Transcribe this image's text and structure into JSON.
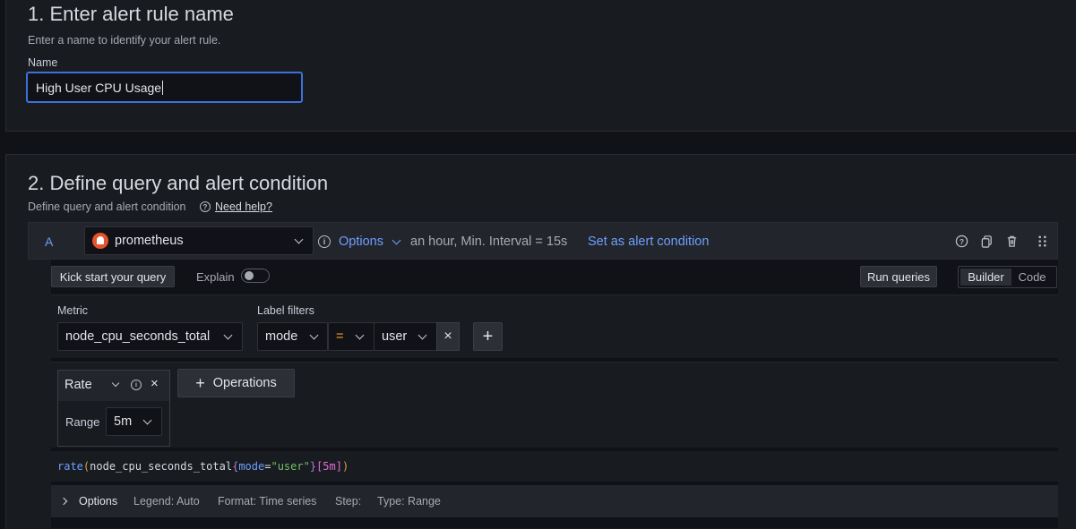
{
  "step1": {
    "title": "1. Enter alert rule name",
    "subtitle": "Enter a name to identify your alert rule.",
    "name_label": "Name",
    "name_value": "High User CPU Usage"
  },
  "step2": {
    "title": "2. Define query and alert condition",
    "subtitle": "Define query and alert condition",
    "help_link": "Need help?"
  },
  "query": {
    "ref_id": "A",
    "datasource": "prometheus",
    "options_label": "Options",
    "options_meta": "an hour, Min. Interval = 15s",
    "set_condition": "Set as alert condition",
    "icons": [
      "help-icon",
      "duplicate-icon",
      "delete-icon",
      "drag-handle-icon"
    ]
  },
  "toolbar": {
    "kick_start": "Kick start your query",
    "explain": "Explain",
    "explain_on": false,
    "run_queries": "Run queries",
    "modes": [
      "Builder",
      "Code"
    ],
    "active_mode": "Builder"
  },
  "builder": {
    "metric_label": "Metric",
    "metric_value": "node_cpu_seconds_total",
    "label_filters_label": "Label filters",
    "filter": {
      "label": "mode",
      "operator": "=",
      "value": "user"
    },
    "operation": {
      "name": "Rate",
      "range_label": "Range",
      "range_value": "5m"
    },
    "operations_button": "Operations"
  },
  "promql": {
    "fn": "rate",
    "open": "(",
    "metric": "node_cpu_seconds_total",
    "brace_open": "{",
    "label": "mode",
    "eq": "=",
    "value": "\"user\"",
    "brace_close": "}",
    "range": "[5m]",
    "close": ")"
  },
  "options_row": {
    "label": "Options",
    "legend": "Legend: Auto",
    "format": "Format: Time series",
    "step": "Step:",
    "type": "Type: Range"
  },
  "colors": {
    "accent": "#6e9fff",
    "focus": "#3d71d9",
    "prometheus": "#e6522c",
    "operator": "#ff9830"
  }
}
